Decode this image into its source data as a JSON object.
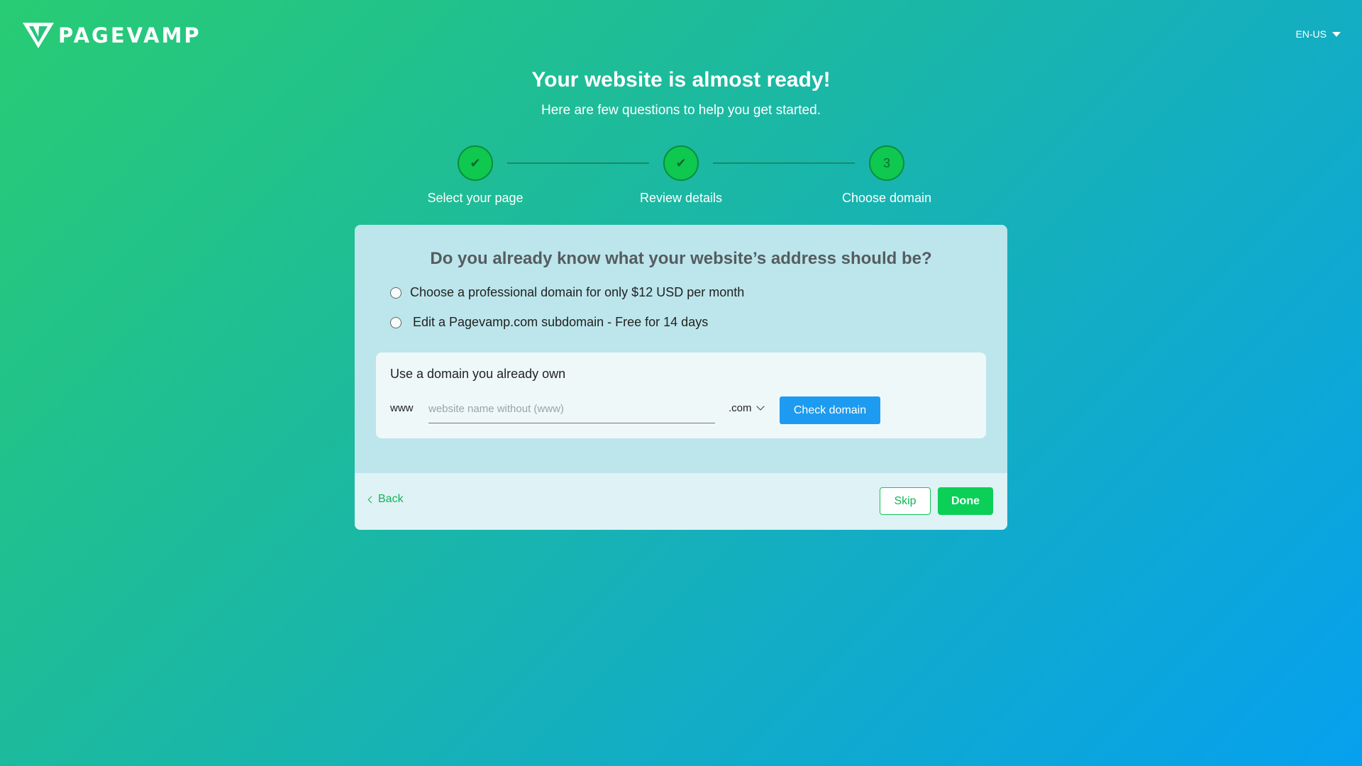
{
  "brand": {
    "name": "PAGEVAMP",
    "logo_icon": "pagevamp-v-logo"
  },
  "language": {
    "selected": "EN-US",
    "icon": "caret-down-icon"
  },
  "header": {
    "title": "Your website is almost ready!",
    "subtitle": "Here are few questions to help you get started."
  },
  "stepper": {
    "steps": [
      {
        "label": "Select your page",
        "status": "complete",
        "marker": "✔"
      },
      {
        "label": "Review details",
        "status": "complete",
        "marker": "✔"
      },
      {
        "label": "Choose domain",
        "status": "current",
        "marker": "3"
      }
    ]
  },
  "card": {
    "question": "Do you already know what your website’s address should be?",
    "options": [
      {
        "label": "Choose a professional domain for only $12 USD per month",
        "selected": false
      },
      {
        "label": "Edit a Pagevamp.com subdomain - Free for 14 days",
        "selected": false
      }
    ],
    "own_domain": {
      "title": "Use a domain you already own",
      "prefix": "www",
      "input_value": "",
      "input_placeholder": "website name without (www)",
      "tld_selected": ".com",
      "check_button": "Check domain"
    }
  },
  "footer": {
    "back_label": "Back",
    "skip_label": "Skip",
    "done_label": "Done"
  },
  "colors": {
    "accent_green": "#0ccf58",
    "accent_blue": "#1d9bf0",
    "gradient_start": "#28cc73",
    "gradient_end": "#06a0ef"
  }
}
